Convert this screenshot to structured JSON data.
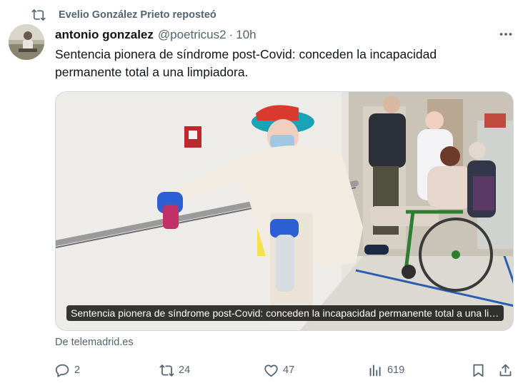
{
  "repost": {
    "text": "Evelio González Prieto reposteó",
    "icon": "repost-icon"
  },
  "author": {
    "name": "antonio gonzalez",
    "handle": "@poetricus2",
    "separator": "·",
    "time": "10h"
  },
  "tweet": {
    "text": "Sentencia pionera de síndrome post-Covid: conceden la incapacidad permanente total a una limpiadora."
  },
  "card": {
    "caption": "Sentencia pionera de síndrome post-Covid: conceden la incapacidad permanente total a una limpiadora.",
    "source": "De telemadrid.es"
  },
  "actions": {
    "replies": "2",
    "reposts": "24",
    "likes": "47",
    "views": "619"
  },
  "colors": {
    "text_primary": "#0f1419",
    "text_secondary": "#536471",
    "border": "#cfd9de"
  }
}
